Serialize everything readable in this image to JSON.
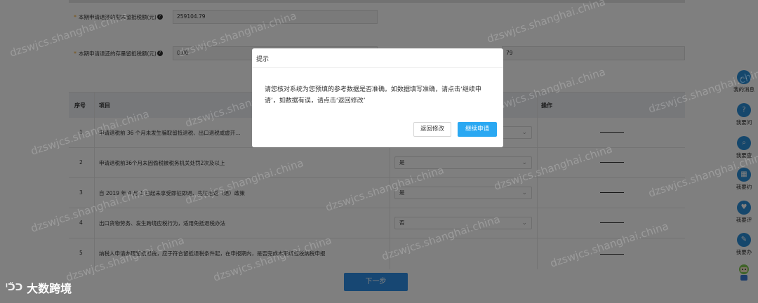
{
  "form": {
    "field1_label": "本期申请退还的期末留抵税额(元)",
    "field1_value": "259104.79",
    "field2_label": "本期申请退还的存量留抵税额(元)",
    "field2_value": "0.00",
    "field3_value": "79"
  },
  "table": {
    "headers": {
      "no": "序号",
      "item": "项目",
      "op": "操作"
    },
    "rows": [
      {
        "no": "1",
        "item": "申请退税前 36 个月未发生骗取留抵退税、出口退税或虚开...",
        "value": "",
        "op": "———"
      },
      {
        "no": "2",
        "item": "申请退税前36个月未因偷税被税务机关处罚2次及以上",
        "value": "是",
        "op": "———"
      },
      {
        "no": "3",
        "item": "自 2019 年 4 月 1 日起未享受即征即退、先征后返（退）政策",
        "value": "是",
        "op": "———"
      },
      {
        "no": "4",
        "item": "出口货物劳务、发生跨境应税行为，适用免抵退税办法",
        "value": "否",
        "op": "———"
      },
      {
        "no": "5",
        "item": "纳税人申请办理留抵退税，应于符合留抵退税条件起，在申报期内，是否完成本期增值税纳税申报",
        "value": "-",
        "op": "———"
      }
    ]
  },
  "next_button": "下一步",
  "sidebar": {
    "items": [
      {
        "label": "我的消息",
        "icon": "message-icon",
        "glyph": "…"
      },
      {
        "label": "我要问",
        "icon": "question-icon",
        "glyph": "?"
      },
      {
        "label": "我要查",
        "icon": "search-icon",
        "glyph": "⌕"
      },
      {
        "label": "我要约",
        "icon": "calendar-icon",
        "glyph": "▦"
      },
      {
        "label": "我要评",
        "icon": "rate-icon",
        "glyph": "♥"
      },
      {
        "label": "我要办",
        "icon": "edit-icon",
        "glyph": "✎"
      }
    ],
    "robot_icon": "robot-assistant-icon"
  },
  "dialog": {
    "title": "提示",
    "message": "请您核对系统为您预填的参考数据是否准确。如数据填写准确，请点击‘继续申请’，如数据有误，请点击‘返回修改’",
    "back_label": "返回修改",
    "continue_label": "继续申请"
  },
  "watermark": "dzswjcs.shanghai.china",
  "logo": "大数跨境",
  "colors": {
    "primary": "#2f8fe6",
    "continue": "#2aa8f2",
    "accent_star": "#f5a623"
  }
}
